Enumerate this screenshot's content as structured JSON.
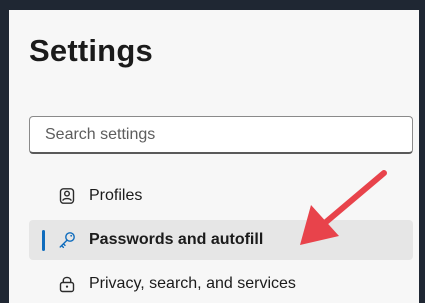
{
  "page": {
    "title": "Settings"
  },
  "search": {
    "placeholder": "Search settings",
    "value": ""
  },
  "sidebar": {
    "items": [
      {
        "label": "Profiles",
        "icon": "profile-icon",
        "selected": false
      },
      {
        "label": "Passwords and autofill",
        "icon": "key-icon",
        "selected": true
      },
      {
        "label": "Privacy, search, and services",
        "icon": "lock-icon",
        "selected": false
      }
    ]
  },
  "annotation": {
    "arrow_color": "#e8434b",
    "icon": "red-arrow-pointer"
  },
  "colors": {
    "accent": "#0f6cbd",
    "selected_background": "#e6e6e6",
    "page_background": "#f7f7f7"
  }
}
